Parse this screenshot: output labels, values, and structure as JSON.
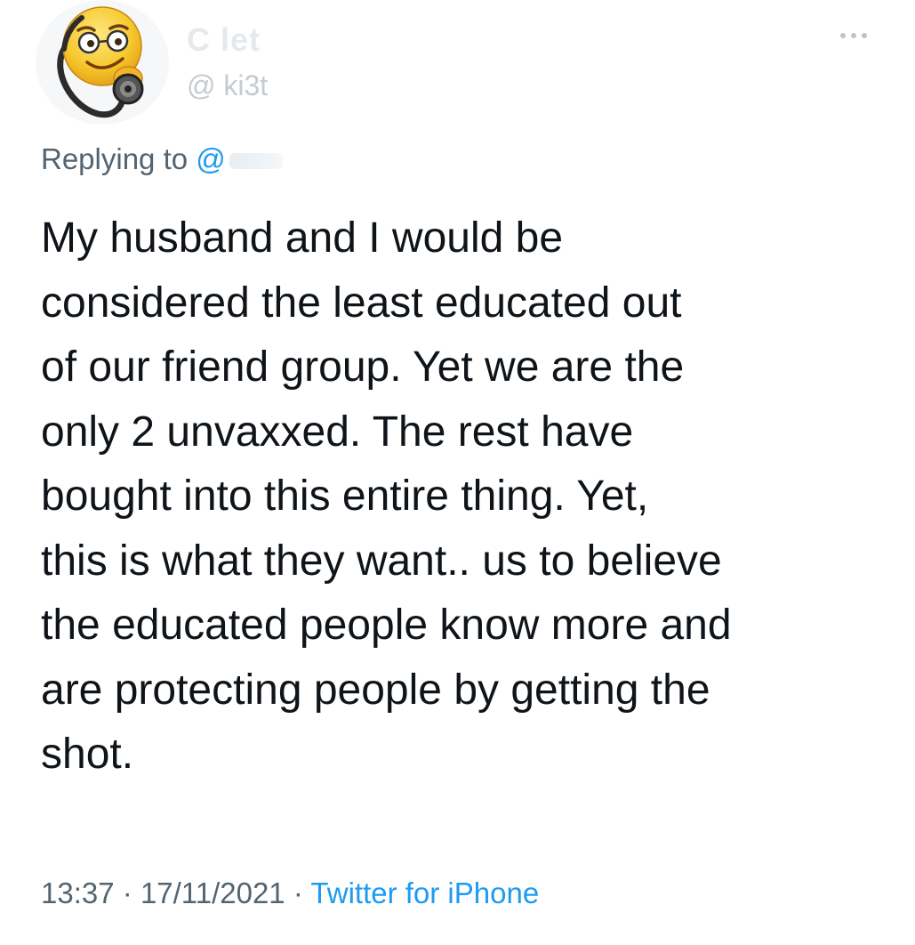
{
  "header": {
    "display_name": "C          let",
    "handle": "@      ki3t",
    "more_icon": "more-horizontal-icon",
    "avatar_icon": "nerd-emoji-with-stethoscope-icon"
  },
  "reply": {
    "prefix": "Replying to",
    "mention": "@"
  },
  "tweet": {
    "text": "My husband and I would be\nconsidered the least educated out\nof our friend group. Yet we are the\nonly 2 unvaxxed. The rest have\nbought into this entire thing. Yet,\nthis is what they want.. us to believe\nthe educated people know more and\nare protecting people by getting the\nshot."
  },
  "meta": {
    "time": "13:37",
    "separator": "·",
    "date": "17/11/2021",
    "source": "Twitter for iPhone"
  },
  "colors": {
    "text": "#0f1419",
    "secondary": "#536471",
    "link": "#1d9bf0",
    "emoji_yellow": "#f6c92f"
  }
}
